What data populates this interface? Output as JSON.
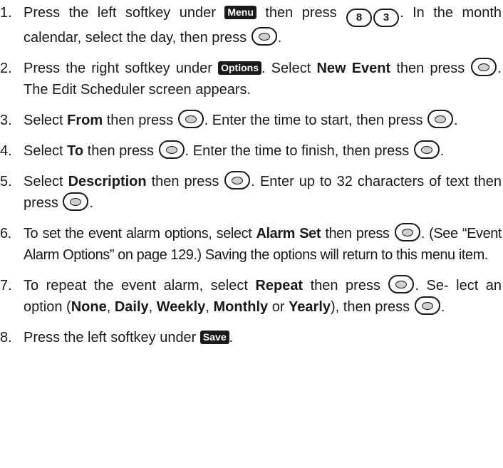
{
  "steps": [
    {
      "num": "1.",
      "a": "Press the left softkey under",
      "sk_menu": "Menu",
      "b": "then press",
      "key8": "8",
      "key3": "3",
      "c": ". In the month calendar, select the day, then press",
      "d": "."
    },
    {
      "num": "2.",
      "a": "Press the right softkey under",
      "sk_options": "Options",
      "b": ". Select",
      "bold1": "New Event",
      "c": "then press",
      "d": ". The Edit Scheduler screen appears."
    },
    {
      "num": "3.",
      "a": "Select",
      "bold1": "From",
      "b": "then press",
      "c": ". Enter the time to start, then press",
      "d": "."
    },
    {
      "num": "4.",
      "a": "Select",
      "bold1": "To",
      "b": "then press",
      "c": ". Enter the time to finish, then press",
      "d": "."
    },
    {
      "num": "5.",
      "a": "Select",
      "bold1": "Description",
      "b": "then press",
      "c": ". Enter up to 32 characters of text then press",
      "d": "."
    },
    {
      "num": "6.",
      "a": "To set the event alarm options, select",
      "bold1": "Alarm Set",
      "b": "then press",
      "c": ". (See “Event Alarm Options” on page 129.) Saving the options will return to this menu item."
    },
    {
      "num": "7.",
      "a": "To repeat the event alarm, select",
      "bold1": "Repeat",
      "b": "then press",
      "c": ". Se- lect an option (",
      "o1": "None",
      "o2": "Daily",
      "o3": "Weekly",
      "o4": "Monthly",
      "o5": "Yearly",
      "sep": ",",
      "or": "or",
      "d": "), then press",
      "e": "."
    },
    {
      "num": "8.",
      "a": "Press the left softkey under",
      "sk_save": "Save",
      "b": "."
    }
  ],
  "icons": {
    "select_key": "ok-select-key-icon",
    "number_key": "number-key-icon",
    "softkey_label": "softkey-label-icon"
  },
  "colors": {
    "text": "#1a1a1a",
    "softkey_bg": "#1a1a1a",
    "softkey_text": "#ffffff"
  }
}
